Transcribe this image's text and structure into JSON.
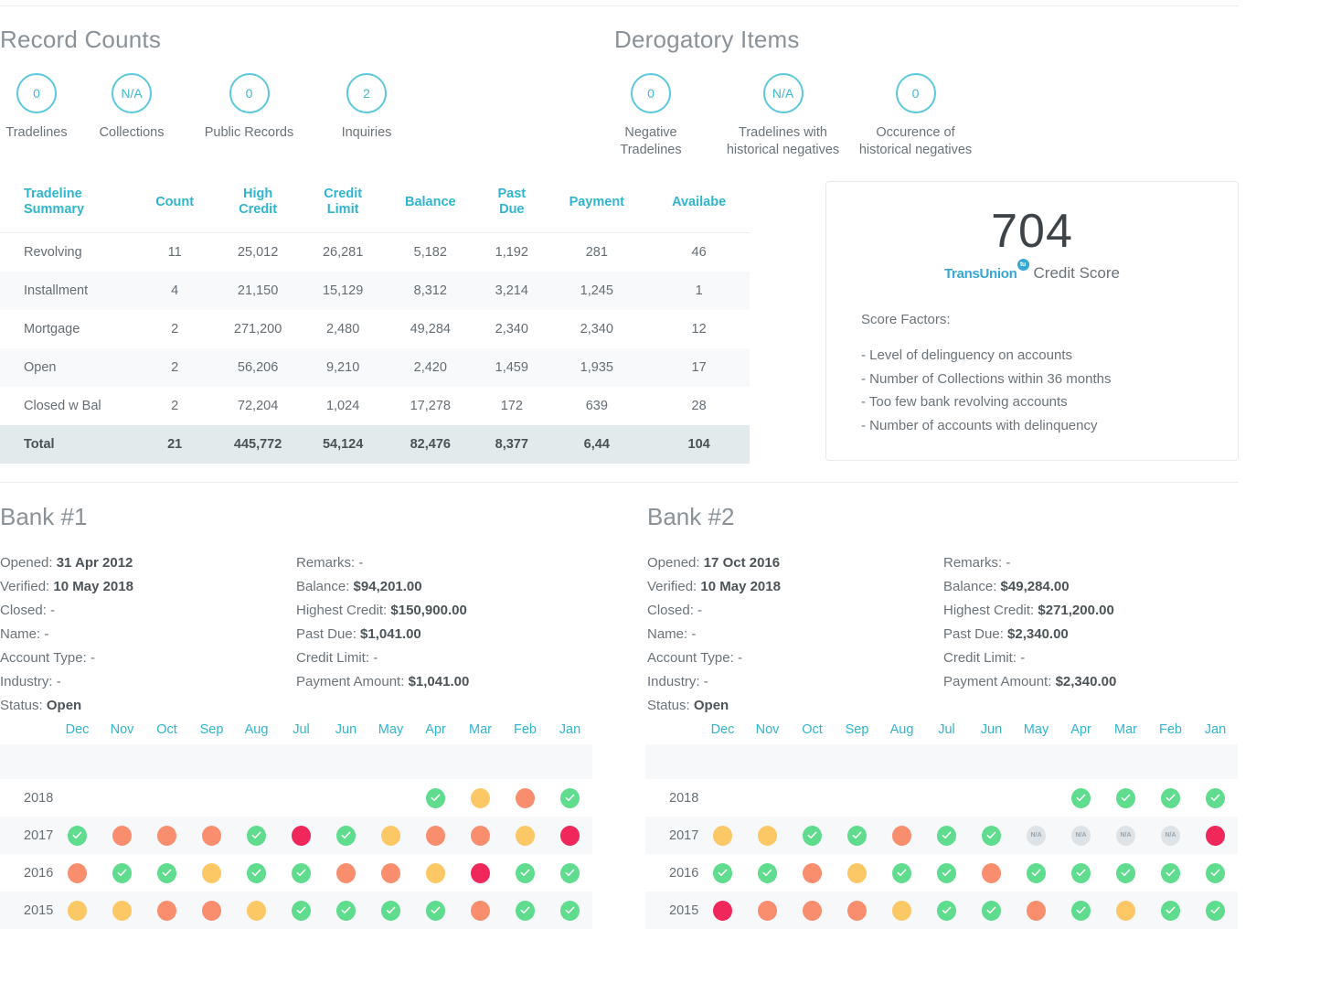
{
  "record_counts": {
    "title": "Record Counts",
    "items": [
      {
        "value": "0",
        "label": "Tradelines"
      },
      {
        "value": "N/A",
        "label": "Collections"
      },
      {
        "value": "0",
        "label": "Public Records"
      },
      {
        "value": "2",
        "label": "Inquiries"
      }
    ]
  },
  "derogatory_items": {
    "title": "Derogatory Items",
    "items": [
      {
        "value": "0",
        "label": "Negative\nTradelines"
      },
      {
        "value": "N/A",
        "label": "Tradelines with\nhistorical negatives"
      },
      {
        "value": "0",
        "label": "Occurence of\nhistorical negatives"
      }
    ]
  },
  "tradeline_table": {
    "headers": [
      "Tradeline\nSummary",
      "Count",
      "High\nCredit",
      "Credit\nLimit",
      "Balance",
      "Past\nDue",
      "Payment",
      "Availabe"
    ],
    "rows": [
      [
        "Revolving",
        "11",
        "25,012",
        "26,281",
        "5,182",
        "1,192",
        "281",
        "46"
      ],
      [
        "Installment",
        "4",
        "21,150",
        "15,129",
        "8,312",
        "3,214",
        "1,245",
        "1"
      ],
      [
        "Mortgage",
        "2",
        "271,200",
        "2,480",
        "49,284",
        "2,340",
        "2,340",
        "12"
      ],
      [
        "Open",
        "2",
        "56,206",
        "9,210",
        "2,420",
        "1,459",
        "1,935",
        "17"
      ],
      [
        "Closed w Bal",
        "2",
        "72,204",
        "1,024",
        "17,278",
        "172",
        "639",
        "28"
      ]
    ],
    "total_row": [
      "Total",
      "21",
      "445,772",
      "54,124",
      "82,476",
      "8,377",
      "6,44",
      "104"
    ]
  },
  "score_card": {
    "score": "704",
    "brand": "TransUnion",
    "brand_mark": "tu",
    "brand_label": "Credit Score",
    "factors_title": "Score Factors:",
    "factors": [
      "- Level of delinguency on accounts",
      "- Number of Collections within 36 months",
      "- Too few bank revolving accounts",
      "- Number of accounts with delinquency"
    ]
  },
  "banks": [
    {
      "title": "Bank #1",
      "left_fields": [
        {
          "label": "Opened:",
          "value": "31 Apr 2012",
          "bold": true
        },
        {
          "label": "Verified:",
          "value": "10 May 2018",
          "bold": true
        },
        {
          "label": "Closed:",
          "value": "-",
          "bold": false
        },
        {
          "label": "Name:",
          "value": "-",
          "bold": false
        },
        {
          "label": "Account Type:",
          "value": "-",
          "bold": false
        },
        {
          "label": "Industry:",
          "value": "-",
          "bold": false
        },
        {
          "label": "Status:",
          "value": "Open",
          "bold": true
        }
      ],
      "right_fields": [
        {
          "label": "Remarks:",
          "value": "-",
          "bold": false
        },
        {
          "label": "Balance:",
          "value": "$94,201.00",
          "bold": true
        },
        {
          "label": "Highest Credit:",
          "value": "$150,900.00",
          "bold": true
        },
        {
          "label": "Past Due:",
          "value": "$1,041.00",
          "bold": true
        },
        {
          "label": "Credit Limit:",
          "value": "-",
          "bold": false
        },
        {
          "label": "Payment Amount:",
          "value": "$1,041.00",
          "bold": true
        }
      ]
    },
    {
      "title": "Bank #2",
      "left_fields": [
        {
          "label": "Opened:",
          "value": "17 Oct 2016",
          "bold": true
        },
        {
          "label": "Verified:",
          "value": "10 May 2018",
          "bold": true
        },
        {
          "label": "Closed:",
          "value": "-",
          "bold": false
        },
        {
          "label": "Name:",
          "value": "-",
          "bold": false
        },
        {
          "label": "Account Type:",
          "value": "-",
          "bold": false
        },
        {
          "label": "Industry:",
          "value": "-",
          "bold": false
        },
        {
          "label": "Status:",
          "value": "Open",
          "bold": true
        }
      ],
      "right_fields": [
        {
          "label": "Remarks:",
          "value": "-",
          "bold": false
        },
        {
          "label": "Balance:",
          "value": "$49,284.00",
          "bold": true
        },
        {
          "label": "Highest Credit:",
          "value": "$271,200.00",
          "bold": true
        },
        {
          "label": "Past Due:",
          "value": "$2,340.00",
          "bold": true
        },
        {
          "label": "Credit Limit:",
          "value": "-",
          "bold": false
        },
        {
          "label": "Payment Amount:",
          "value": "$2,340.00",
          "bold": true
        }
      ]
    }
  ],
  "payment_history": {
    "months": [
      "Dec",
      "Nov",
      "Oct",
      "Sep",
      "Aug",
      "Jul",
      "Jun",
      "May",
      "Apr",
      "Mar",
      "Feb",
      "Jan"
    ],
    "legend": {
      "g": "ok-green-check",
      "y": "late-yellow",
      "o": "late-orange",
      "r": "severe-red",
      "n": "not-available-gray",
      "e": "empty"
    },
    "colors": {
      "green": "#5fdc8e",
      "yellow": "#fcc765",
      "orange": "#f98e6e",
      "red": "#f0275b",
      "gray": "#dde3e6",
      "teal": "#2fb5cf"
    },
    "bank1": [
      {
        "year": "2018",
        "cells": [
          "e",
          "e",
          "e",
          "e",
          "e",
          "e",
          "e",
          "e",
          "g",
          "y",
          "o",
          "g"
        ]
      },
      {
        "year": "2017",
        "cells": [
          "g",
          "o",
          "o",
          "o",
          "g",
          "r",
          "g",
          "y",
          "o",
          "o",
          "y",
          "r"
        ]
      },
      {
        "year": "2016",
        "cells": [
          "o",
          "g",
          "g",
          "y",
          "g",
          "g",
          "o",
          "o",
          "y",
          "r",
          "g",
          "g"
        ]
      },
      {
        "year": "2015",
        "cells": [
          "y",
          "y",
          "o",
          "o",
          "y",
          "g",
          "g",
          "g",
          "g",
          "o",
          "g",
          "g"
        ]
      }
    ],
    "bank2": [
      {
        "year": "2018",
        "cells": [
          "e",
          "e",
          "e",
          "e",
          "e",
          "e",
          "e",
          "e",
          "g",
          "g",
          "g",
          "g"
        ]
      },
      {
        "year": "2017",
        "cells": [
          "y",
          "y",
          "g",
          "g",
          "o",
          "g",
          "g",
          "n",
          "n",
          "n",
          "n",
          "r"
        ]
      },
      {
        "year": "2016",
        "cells": [
          "g",
          "g",
          "o",
          "y",
          "g",
          "g",
          "o",
          "g",
          "g",
          "g",
          "g",
          "g"
        ]
      },
      {
        "year": "2015",
        "cells": [
          "r",
          "o",
          "o",
          "o",
          "y",
          "g",
          "g",
          "o",
          "g",
          "y",
          "g",
          "g"
        ]
      }
    ],
    "na_text": "N/A"
  }
}
